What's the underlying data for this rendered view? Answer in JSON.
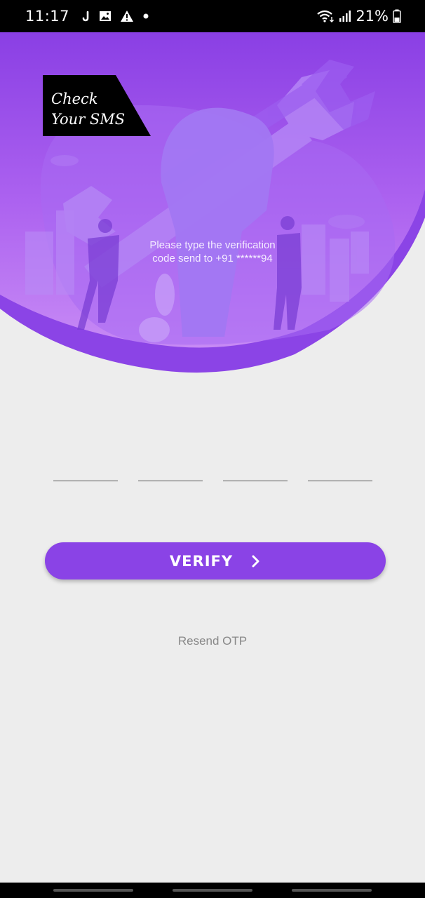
{
  "status_bar": {
    "time": "11:17",
    "battery": "21%",
    "icons": [
      "j-app-icon",
      "image-icon",
      "warning-icon",
      "dot-icon",
      "wifi-icon",
      "signal-icon",
      "battery-icon"
    ]
  },
  "header": {
    "badge_text": "Check\nYour SMS",
    "message": "Please type the verification\ncode send to +91 ******94"
  },
  "otp": {
    "slots": [
      "",
      "",
      "",
      ""
    ]
  },
  "actions": {
    "verify_label": "VERIFY",
    "resend_label": "Resend OTP"
  },
  "colors": {
    "primary": "#8a43e6",
    "hero_top": "#8a3fe4",
    "hero_bottom": "#c27cf4",
    "background": "#ededed"
  }
}
